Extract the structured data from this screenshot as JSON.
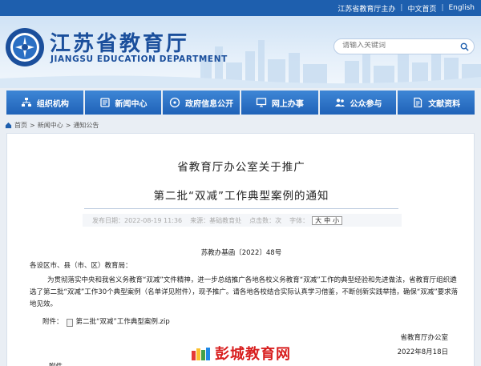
{
  "topbar": {
    "host": "江苏省教育厅主办",
    "home": "中文首页",
    "english": "English"
  },
  "header": {
    "title": "江苏省教育厅",
    "subtitle": "JIANGSU EDUCATION DEPARTMENT"
  },
  "search": {
    "placeholder": "请输入关键词"
  },
  "nav": {
    "items": [
      {
        "label": "组织机构",
        "icon": "org-icon"
      },
      {
        "label": "新闻中心",
        "icon": "news-icon"
      },
      {
        "label": "政府信息公开",
        "icon": "disc-icon"
      },
      {
        "label": "网上办事",
        "icon": "monitor-icon"
      },
      {
        "label": "公众参与",
        "icon": "people-icon"
      },
      {
        "label": "文献资料",
        "icon": "document-icon"
      }
    ]
  },
  "breadcrumb": {
    "home": "首页",
    "news": "新闻中心",
    "notice": "通知公告",
    "sep": ">"
  },
  "article": {
    "title_line1": "省教育厅办公室关于推广",
    "title_line2": "第二批“双减”工作典型案例的通知",
    "published": "发布日期：2022-08-19 11:36",
    "source": "来源：基础教育处",
    "views": "点击数：次",
    "fontsize_label": "字体：",
    "fontsize_large": "大",
    "fontsize_medium": "中",
    "fontsize_small": "小",
    "doc_number": "苏教办基函〔2022〕48号",
    "salutation": "各设区市、县（市、区）教育局：",
    "body": "为贯彻落实中央和我省义务教育“双减”文件精神，进一步总结推广各地各校义务教育“双减”工作的典型经验和先进做法，省教育厅组织遴选了第二批“双减”工作30个典型案例（名单详见附件），现予推广。请各地各校结合实际认真学习借鉴，不断创新实践举措，确保“双减”要求落地见效。",
    "attachment_label": "附件：",
    "attachment_name": "第二批“双减”工作典型案例.zip",
    "signature": "省教育厅办公室",
    "date": "2022年8月18日",
    "footnote": "附件"
  },
  "watermark": {
    "text": "彭城教育网"
  },
  "colors": {
    "primary": "#1e5fae",
    "nav": "#2a6fc4",
    "watermark": "#d81e1e"
  }
}
